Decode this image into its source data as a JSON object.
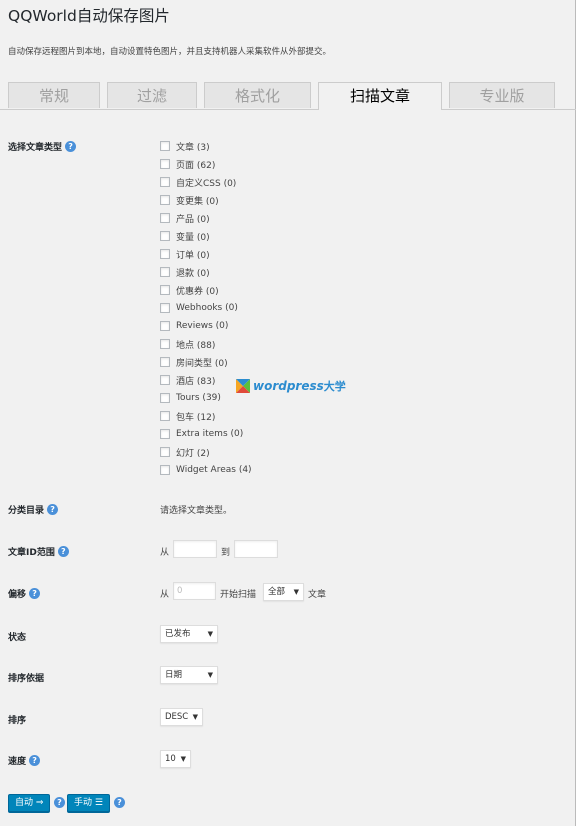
{
  "title": "QQWorld自动保存图片",
  "description": "自动保存远程图片到本地，自动设置特色图片，并且支持机器人采集软件从外部提交。",
  "tabs": [
    {
      "label": "常规"
    },
    {
      "label": "过滤"
    },
    {
      "label": "格式化"
    },
    {
      "label": "扫描文章",
      "active": true
    },
    {
      "label": "专业版"
    }
  ],
  "post_types": {
    "label": "选择文章类型",
    "items": [
      "文章 (3)",
      "页面 (62)",
      "自定义CSS (0)",
      "变更集 (0)",
      "产品 (0)",
      "变量 (0)",
      "订单 (0)",
      "退款 (0)",
      "优惠券 (0)",
      "Webhooks (0)",
      "Reviews (0)",
      "地点 (88)",
      "房间类型 (0)",
      "酒店 (83)",
      "Tours (39)",
      "包车 (12)",
      "Extra items (0)",
      "幻灯 (2)",
      "Widget Areas (4)"
    ]
  },
  "category": {
    "label": "分类目录",
    "value": "请选择文章类型。"
  },
  "id_range": {
    "label": "文章ID范围",
    "from": "从",
    "to": "到"
  },
  "offset": {
    "label": "偏移",
    "from": "从",
    "placeholder": "0",
    "start": "开始扫描",
    "select": "全部",
    "suffix": "文章"
  },
  "status": {
    "label": "状态",
    "value": "已发布"
  },
  "orderby": {
    "label": "排序依据",
    "value": "日期"
  },
  "order": {
    "label": "排序",
    "value": "DESC"
  },
  "speed": {
    "label": "速度",
    "value": "10"
  },
  "buttons": {
    "auto": "自动 ⇒",
    "manual": "手动 ☰"
  },
  "watermark": {
    "latin": "wordpress",
    "cn": "大学"
  },
  "help_glyph": "?",
  "colors": {
    "button": "#0085ba",
    "help": "#4a90d9",
    "watermark": "#2c8ccf"
  }
}
